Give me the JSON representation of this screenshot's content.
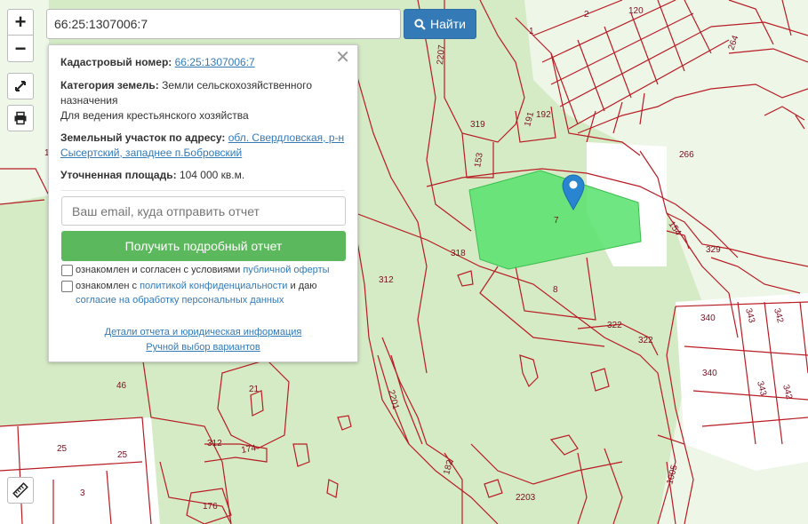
{
  "search": {
    "value": "66:25:1307006:7",
    "button_label": "Найти"
  },
  "zoom": {
    "in_label": "+",
    "out_label": "−"
  },
  "toolbar": {
    "fullscreen_icon": "expand-icon",
    "print_icon": "printer-icon",
    "ruler_icon": "ruler-icon"
  },
  "info": {
    "cadastral_label": "Кадастровый номер:",
    "cadastral_value": "66:25:1307006:7",
    "category_label": "Категория земель:",
    "category_value": "Земли сельскохозяйственного назначения",
    "usage": "Для ведения крестьянского хозяйства",
    "address_label": "Земельный участок по адресу:",
    "address_value": "обл. Свердловская, р-н Сысертский, западнее п.Бобровский",
    "area_label": "Уточненная площадь:",
    "area_value": "104 000 кв.м."
  },
  "form": {
    "email_placeholder": "Ваш email, куда отправить отчет",
    "submit_label": "Получить подробный отчет",
    "consent1_prefix": "ознакомлен и согласен с условиями",
    "consent1_link": "публичной оферты",
    "consent2_prefix": "ознакомлен с",
    "consent2_link": "политикой конфиденциальности",
    "consent2_middle": "и даю",
    "consent2_link2": "согласие на обработку персональных данных",
    "details_link": "Детали отчета и юридическая информация",
    "manual_link": "Ручной выбор вариантов"
  },
  "map": {
    "selected_plot_label": "7",
    "selected_fill": "#5be36f",
    "boundary_color": "#b81c24",
    "background_color": "#d5ebc5",
    "plot_labels": [
      "2",
      "120",
      "1",
      "264",
      "2207",
      "319",
      "191",
      "192",
      "153",
      "266",
      "154",
      "329",
      "318",
      "312",
      "8",
      "322",
      "322",
      "340",
      "343",
      "342",
      "340",
      "343",
      "342",
      "46",
      "21",
      "2201",
      "312",
      "174",
      "25",
      "25",
      "3",
      "176",
      "182",
      "2203",
      "1005",
      "1"
    ]
  }
}
